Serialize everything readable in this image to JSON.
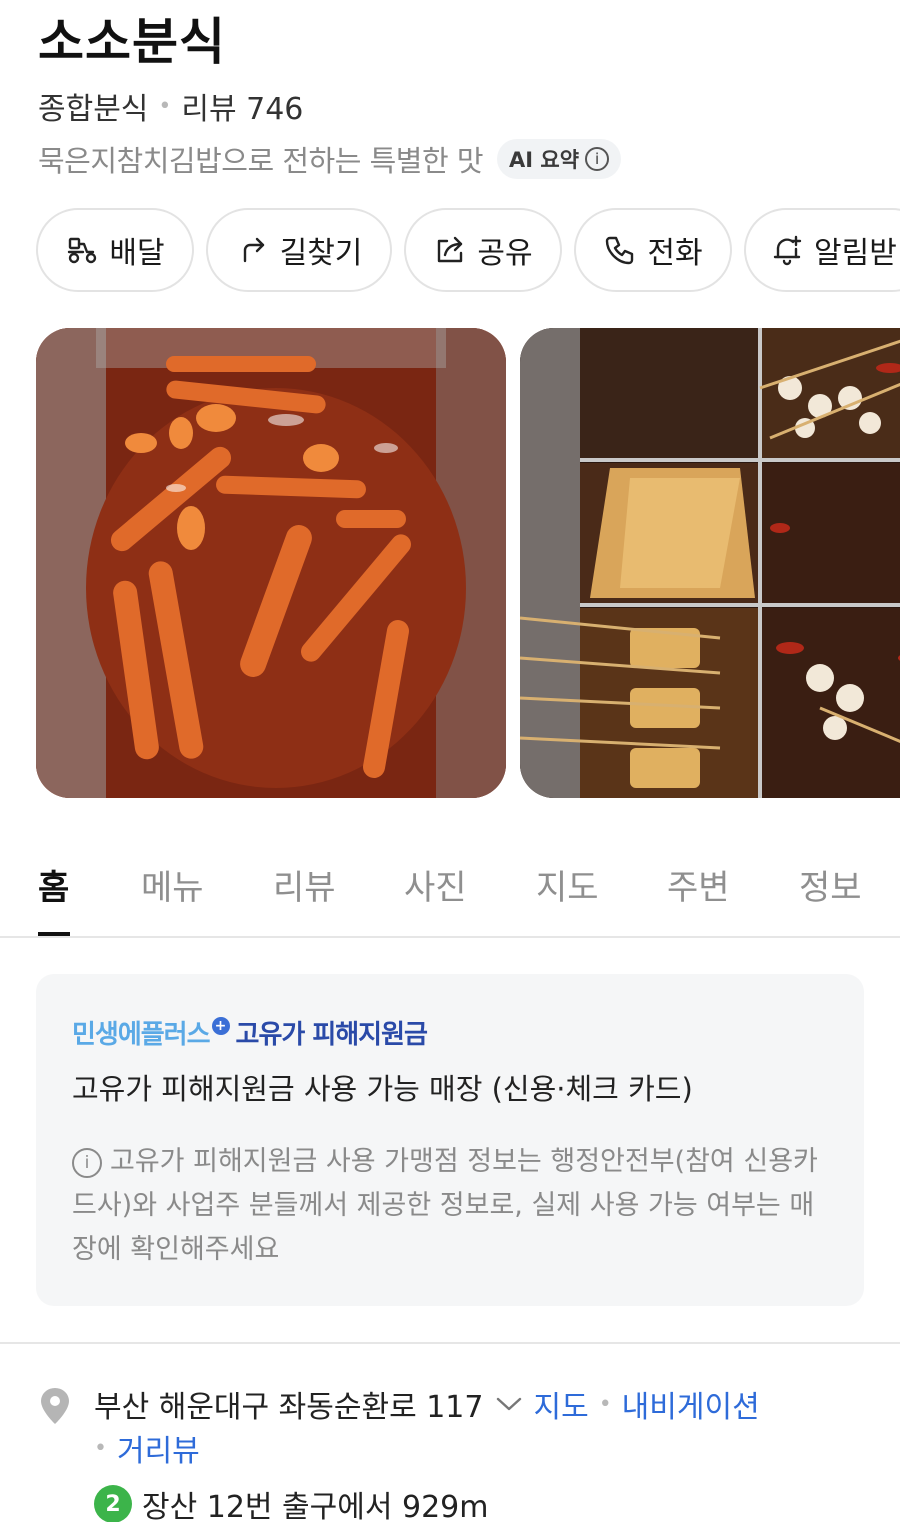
{
  "place": {
    "name": "소소분식",
    "category": "종합분식",
    "review_label": "리뷰 746",
    "summary": "묵은지참치김밥으로 전하는 특별한 맛",
    "ai_chip": "AI 요약"
  },
  "actions": [
    {
      "label": "배달",
      "icon": "delivery-scooter-icon"
    },
    {
      "label": "길찾기",
      "icon": "directions-arrow-icon"
    },
    {
      "label": "공유",
      "icon": "share-icon"
    },
    {
      "label": "전화",
      "icon": "phone-icon"
    },
    {
      "label": "알림받",
      "icon": "bell-plus-icon"
    }
  ],
  "photos": [
    {
      "alt": "tteokbokki-photo"
    },
    {
      "alt": "fish-cake-skewers-photo"
    }
  ],
  "tabs": [
    {
      "label": "홈",
      "active": true
    },
    {
      "label": "메뉴",
      "active": false
    },
    {
      "label": "리뷰",
      "active": false
    },
    {
      "label": "사진",
      "active": false
    },
    {
      "label": "지도",
      "active": false
    },
    {
      "label": "주변",
      "active": false
    },
    {
      "label": "정보",
      "active": false
    }
  ],
  "promo": {
    "brand": "민생에플러스",
    "brand_sub": "고유가 피해지원금",
    "title": "고유가 피해지원금 사용 가능 매장 (신용·체크 카드)",
    "note": "고유가 피해지원금 사용 가맹점 정보는 행정안전부(참여 신용카드사)와 사업주 분들께서 제공한 정보로, 실제 사용 가능 여부는 매장에 확인해주세요"
  },
  "address": {
    "text": "부산 해운대구 좌동순환로 117",
    "map_link": "지도",
    "navi_link": "내비게이션",
    "street_view_link": "거리뷰",
    "subway_line": "2",
    "subway_text": "장산 12번 출구에서 929m"
  },
  "colors": {
    "link": "#2e6bd9",
    "subway_line2": "#3cb44a",
    "promo_brand": "#5aa9e6"
  }
}
